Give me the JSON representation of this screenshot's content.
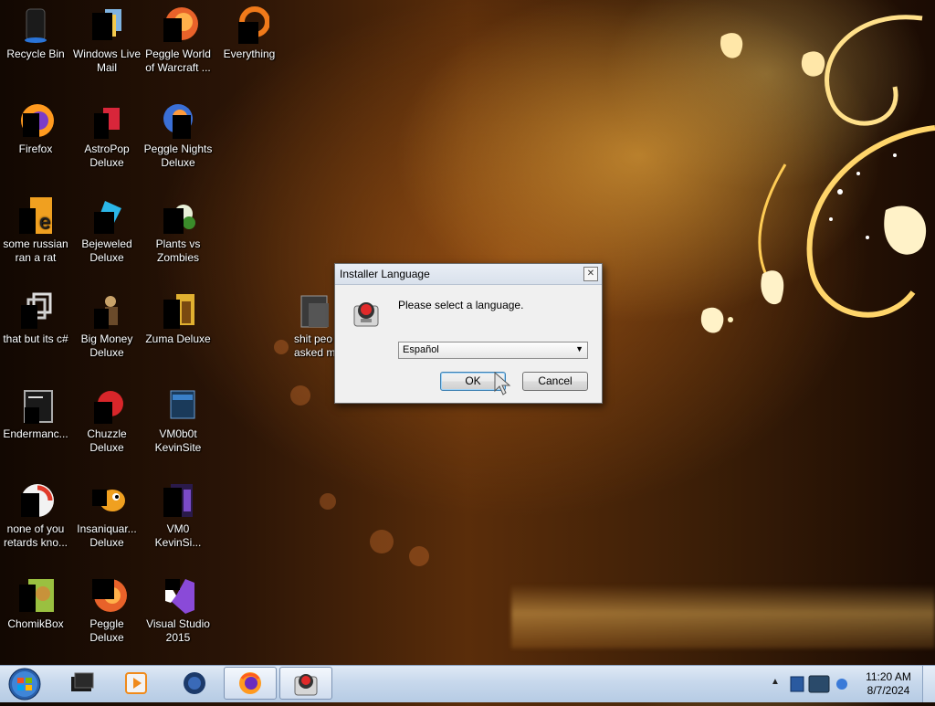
{
  "desktop": {
    "icons": [
      {
        "label": "Recycle Bin",
        "icon": "recycle-bin-icon"
      },
      {
        "label": "Windows Live Mail",
        "icon": "mail-icon"
      },
      {
        "label": "Peggle World of Warcraft ...",
        "icon": "peggle-icon"
      },
      {
        "label": "Everything",
        "icon": "search-app-icon"
      },
      {
        "label": "Firefox",
        "icon": "firefox-icon"
      },
      {
        "label": "AstroPop Deluxe",
        "icon": "game-icon"
      },
      {
        "label": "Peggle Nights Deluxe",
        "icon": "peggle-icon"
      },
      {
        "label": "some russian ran a rat",
        "icon": "file-icon"
      },
      {
        "label": "Bejeweled Deluxe",
        "icon": "gem-icon"
      },
      {
        "label": "Plants vs Zombies",
        "icon": "plant-icon"
      },
      {
        "label": "that but its c#",
        "icon": "shortcut-icon"
      },
      {
        "label": "Big Money Deluxe",
        "icon": "money-icon"
      },
      {
        "label": "Zuma Deluxe",
        "icon": "zuma-icon"
      },
      {
        "label": "shit peo asked m",
        "icon": "folder-icon"
      },
      {
        "label": "Endermanc...",
        "icon": "terminal-icon"
      },
      {
        "label": "Chuzzle Deluxe",
        "icon": "chuzzle-icon"
      },
      {
        "label": "VM0b0t KevinSite",
        "icon": "vm-icon"
      },
      {
        "label": "none of you retards kno...",
        "icon": "app-icon"
      },
      {
        "label": "Insaniquar... Deluxe",
        "icon": "fish-icon"
      },
      {
        "label": "VM0 KevinSi...",
        "icon": "document-icon"
      },
      {
        "label": "ChomikBox",
        "icon": "chomikbox-icon"
      },
      {
        "label": "Peggle Deluxe",
        "icon": "peggle-icon"
      },
      {
        "label": "Visual Studio 2015",
        "icon": "visual-studio-icon"
      }
    ]
  },
  "dialog": {
    "title": "Installer Language",
    "close_label": "✕",
    "message": "Please select a language.",
    "selected_language": "Español",
    "ok_label": "OK",
    "cancel_label": "Cancel"
  },
  "taskbar": {
    "items": [
      {
        "name": "start-button",
        "icon": "windows-orb-icon"
      },
      {
        "name": "taskbar-terminal",
        "icon": "terminal-icon"
      },
      {
        "name": "taskbar-media-player",
        "icon": "media-player-icon"
      },
      {
        "name": "taskbar-globe",
        "icon": "globe-icon"
      },
      {
        "name": "taskbar-firefox",
        "icon": "firefox-icon"
      },
      {
        "name": "taskbar-installer",
        "icon": "installer-icon"
      }
    ],
    "tray_arrow": "▲",
    "time": "11:20 AM",
    "date": "8/7/2024"
  }
}
